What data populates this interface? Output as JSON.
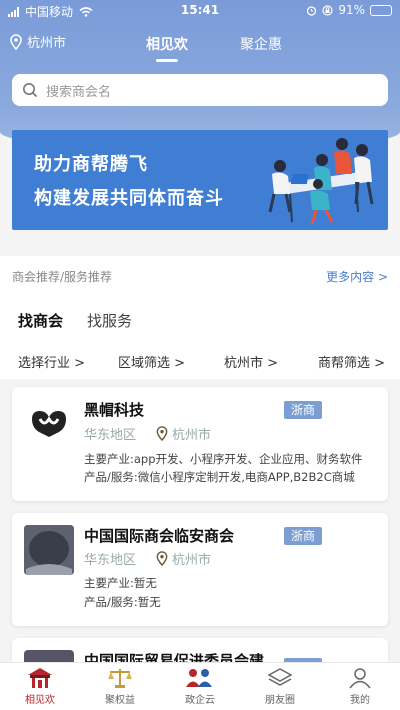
{
  "status_bar": {
    "carrier": "中国移动",
    "time": "15:41",
    "battery": "91%",
    "battery_level": 0.91
  },
  "nav": {
    "location": "杭州市",
    "tabs": [
      "相见欢",
      "聚企惠"
    ]
  },
  "search": {
    "placeholder": "搜索商会名"
  },
  "banner": {
    "line1": "助力商帮腾飞",
    "line2": "构建发展共同体而奋斗"
  },
  "recommend": {
    "label": "商会推荐/服务推荐",
    "more": "更多内容 >"
  },
  "find_tabs": [
    "找商会",
    "找服务"
  ],
  "filters": [
    "选择行业 >",
    "区域筛选 >",
    "杭州市 >",
    "商帮筛选 >"
  ],
  "cards": [
    {
      "name": "黑帽科技",
      "tag": "浙商",
      "region": "华东地区",
      "city": "杭州市",
      "industry": "主要产业:app开发、小程序开发、企业应用、财务软件",
      "service": "产品/服务:微信小程序定制开发,电商APP,B2B2C商城"
    },
    {
      "name": "中国国际商会临安商会",
      "tag": "浙商",
      "region": "华东地区",
      "city": "杭州市",
      "industry": "主要产业:暂无",
      "service": "产品/服务:暂无"
    },
    {
      "name": "中国国际贸易促进委员会建",
      "tag": "",
      "region": "",
      "city": "",
      "industry": "",
      "service": ""
    }
  ],
  "tabbar": [
    "相见欢",
    "聚权益",
    "政企云",
    "朋友圈",
    "我的"
  ],
  "colors": {
    "header": "#7a9bd8",
    "banner": "#3f7ed3",
    "tag": "#7c9fd3",
    "active_tab": "#b5272a"
  }
}
